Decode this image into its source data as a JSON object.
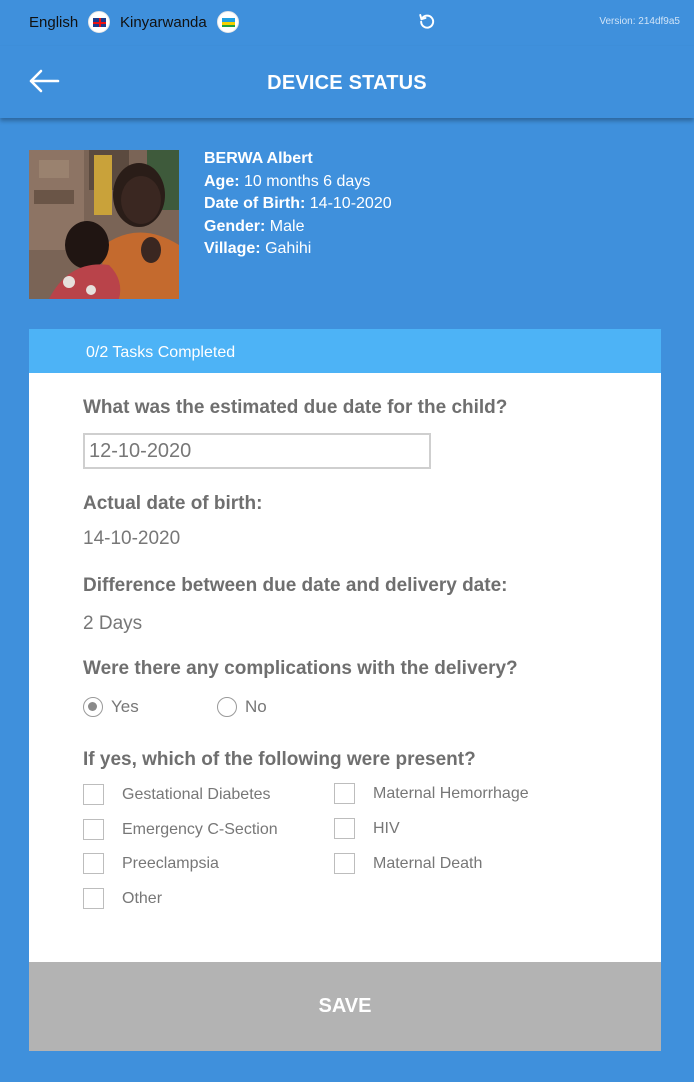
{
  "topbar": {
    "languages": [
      {
        "label": "English",
        "flag_icon": "uk-flag-icon"
      },
      {
        "label": "Kinyarwanda",
        "flag_icon": "rwanda-flag-icon"
      }
    ],
    "refresh_icon": "refresh-icon",
    "version": "Version: 214df9a5"
  },
  "header": {
    "back_icon": "arrow-left-icon",
    "title": "DEVICE STATUS"
  },
  "profile": {
    "name": "BERWA Albert",
    "age_label": "Age:",
    "age": "10 months 6 days",
    "dob_label": "Date of Birth:",
    "dob": "14-10-2020",
    "gender_label": "Gender:",
    "gender": "Male",
    "village_label": "Village:",
    "village": "Gahihi"
  },
  "form": {
    "tasks": "0/2 Tasks Completed",
    "q_due_date": "What was the estimated due date for the child?",
    "due_date_value": "12-10-2020",
    "q_actual_dob": "Actual date of birth:",
    "actual_dob_value": "14-10-2020",
    "q_difference": "Difference between due date and delivery date:",
    "difference_value": "2 Days",
    "q_complications": "Were there any complications with the delivery?",
    "radio_yes": "Yes",
    "radio_no": "No",
    "selected": "Yes",
    "q_conditions": "If yes, which of the following were present?",
    "conditions_left": [
      "Gestational Diabetes",
      "Emergency C-Section",
      "Preeclampsia",
      "Other"
    ],
    "conditions_right": [
      "Maternal Hemorrhage",
      "HIV",
      "Maternal Death"
    ],
    "save_label": "SAVE"
  },
  "colors": {
    "background": "#3f90dc",
    "card_header": "#4db3f6",
    "save_bar": "#b3b3b3"
  }
}
